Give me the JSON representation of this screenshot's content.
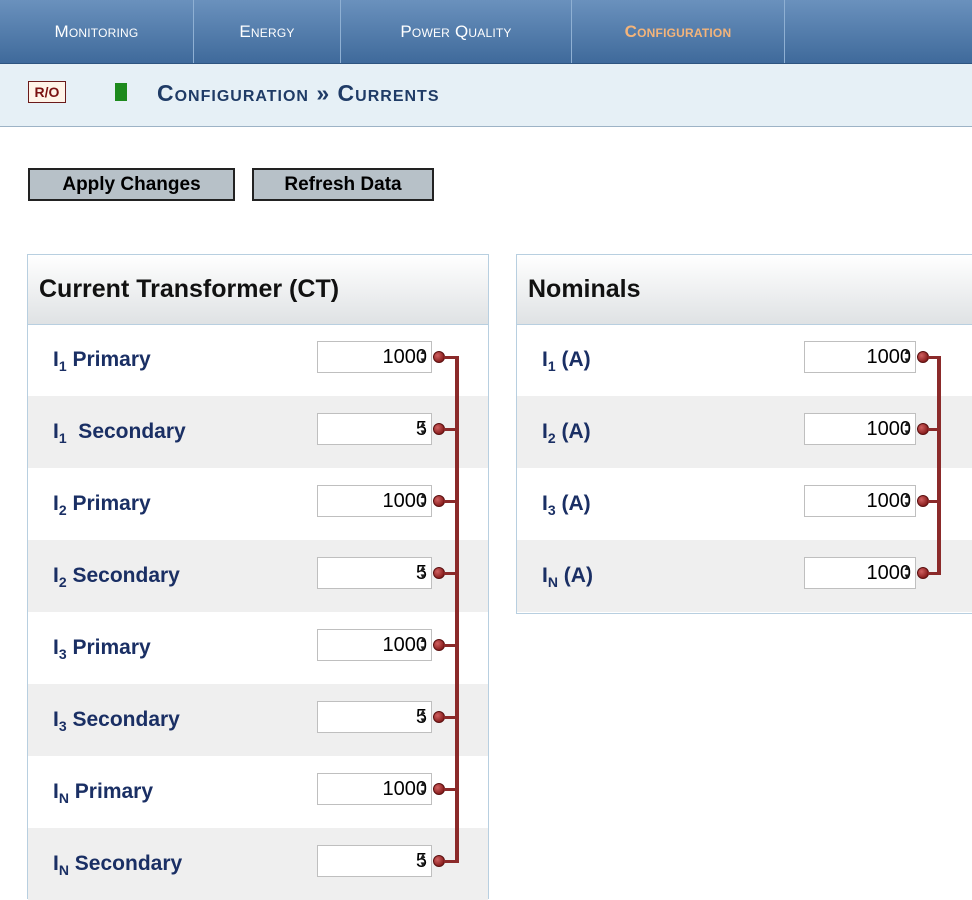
{
  "nav": {
    "tabs": [
      {
        "label": "Monitoring",
        "active": false
      },
      {
        "label": "Energy",
        "active": false
      },
      {
        "label": "Power Quality",
        "active": false
      },
      {
        "label": "Configuration",
        "active": true
      }
    ]
  },
  "header": {
    "ro_badge": "R/O",
    "status_color": "#1d8a1d",
    "title": "Configuration » Currents"
  },
  "toolbar": {
    "apply_label": "Apply Changes",
    "refresh_label": "Refresh Data"
  },
  "ct_panel": {
    "title": "Current Transformer (CT)",
    "rows": [
      {
        "label_main": "I",
        "label_sub": "1",
        "label_rest": " Primary",
        "value": "1000"
      },
      {
        "label_main": "I",
        "label_sub": "1",
        "label_rest": "  Secondary",
        "value": "5"
      },
      {
        "label_main": "I",
        "label_sub": "2",
        "label_rest": " Primary",
        "value": "1000"
      },
      {
        "label_main": "I",
        "label_sub": "2",
        "label_rest": " Secondary",
        "value": "5"
      },
      {
        "label_main": "I",
        "label_sub": "3",
        "label_rest": " Primary",
        "value": "1000"
      },
      {
        "label_main": "I",
        "label_sub": "3",
        "label_rest": " Secondary",
        "value": "5"
      },
      {
        "label_main": "I",
        "label_sub": "N",
        "label_rest": " Primary",
        "value": "1000"
      },
      {
        "label_main": "I",
        "label_sub": "N",
        "label_rest": " Secondary",
        "value": "5"
      }
    ]
  },
  "nominals_panel": {
    "title": "Nominals",
    "rows": [
      {
        "label_main": "I",
        "label_sub": "1",
        "label_rest": " (A)",
        "value": "1000"
      },
      {
        "label_main": "I",
        "label_sub": "2",
        "label_rest": " (A)",
        "value": "1000"
      },
      {
        "label_main": "I",
        "label_sub": "3",
        "label_rest": " (A)",
        "value": "1000"
      },
      {
        "label_main": "I",
        "label_sub": "N",
        "label_rest": " (A)",
        "value": "1000"
      }
    ]
  },
  "colors": {
    "nav_bg": "#4f7aab",
    "active_tab": "#f4b47a",
    "label_text": "#1a2f64",
    "link_bus": "#8b2a2a"
  },
  "icons": {
    "spinner": "up-down-spinner-icon",
    "link_knob": "link-knob-icon"
  }
}
